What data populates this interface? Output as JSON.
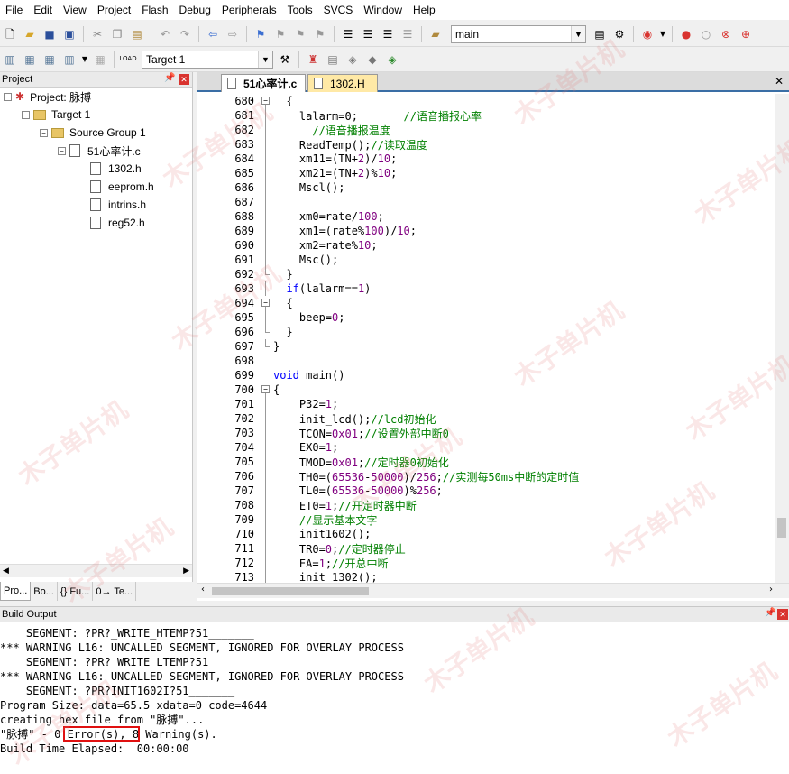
{
  "menu": [
    "File",
    "Edit",
    "View",
    "Project",
    "Flash",
    "Debug",
    "Peripherals",
    "Tools",
    "SVCS",
    "Window",
    "Help"
  ],
  "toolbar1": {
    "combo_value": "main"
  },
  "toolbar2": {
    "target_combo": "Target 1"
  },
  "project_panel": {
    "title": "Project",
    "tree": {
      "project": "Project: 脉搏",
      "target": "Target 1",
      "group": "Source Group 1",
      "file": "51心率计.c",
      "headers": [
        "1302.h",
        "eeprom.h",
        "intrins.h",
        "reg52.h"
      ]
    },
    "tabs": [
      "Pro...",
      "Bo...",
      "{} Fu...",
      "0→ Te..."
    ]
  },
  "editor": {
    "tabs": [
      {
        "label": "51心率计.c",
        "active": true
      },
      {
        "label": "1302.H",
        "active": false
      }
    ],
    "lines": [
      {
        "n": "680",
        "fold": "box",
        "html": "  {"
      },
      {
        "n": "681",
        "fold": "line",
        "html": "    lalarm=0;       <span class='cm'>//语音播报心率</span>"
      },
      {
        "n": "682",
        "fold": "line",
        "html": "      <span class='cm'>//语音播报温度</span>"
      },
      {
        "n": "683",
        "fold": "line",
        "html": "    ReadTemp();<span class='cm'>//读取温度</span>"
      },
      {
        "n": "684",
        "fold": "line",
        "html": "    xm11=(TN+<span class='nm'>2</span>)/<span class='nm'>10</span>;"
      },
      {
        "n": "685",
        "fold": "line",
        "html": "    xm21=(TN+<span class='nm'>2</span>)%<span class='nm'>10</span>;"
      },
      {
        "n": "686",
        "fold": "line",
        "html": "    Mscl();"
      },
      {
        "n": "687",
        "fold": "line",
        "html": ""
      },
      {
        "n": "688",
        "fold": "line",
        "html": "    xm0=rate/<span class='nm'>100</span>;"
      },
      {
        "n": "689",
        "fold": "line",
        "html": "    xm1=(rate%<span class='nm'>100</span>)/<span class='nm'>10</span>;"
      },
      {
        "n": "690",
        "fold": "line",
        "html": "    xm2=rate%<span class='nm'>10</span>;"
      },
      {
        "n": "691",
        "fold": "line",
        "html": "    Msc();"
      },
      {
        "n": "692",
        "fold": "end",
        "html": "  }"
      },
      {
        "n": "693",
        "fold": "line",
        "html": "  <span class='kw'>if</span>(lalarm==<span class='nm'>1</span>)"
      },
      {
        "n": "694",
        "fold": "box",
        "html": "  {"
      },
      {
        "n": "695",
        "fold": "line",
        "html": "    beep=<span class='nm'>0</span>;"
      },
      {
        "n": "696",
        "fold": "end",
        "html": "  }"
      },
      {
        "n": "697",
        "fold": "end",
        "html": "}"
      },
      {
        "n": "698",
        "fold": "none",
        "html": ""
      },
      {
        "n": "699",
        "fold": "none",
        "html": "<span class='kw'>void</span> main()"
      },
      {
        "n": "700",
        "fold": "box",
        "html": "{"
      },
      {
        "n": "701",
        "fold": "line",
        "html": "    P32=<span class='nm'>1</span>;"
      },
      {
        "n": "702",
        "fold": "line",
        "html": "    init_lcd();<span class='cm'>//lcd初始化</span>"
      },
      {
        "n": "703",
        "fold": "line",
        "html": "    TCON=<span class='nm'>0x01</span>;<span class='cm'>//设置外部中断0</span>"
      },
      {
        "n": "704",
        "fold": "line",
        "html": "    EX0=<span class='nm'>1</span>;"
      },
      {
        "n": "705",
        "fold": "line",
        "html": "    TMOD=<span class='nm'>0x01</span>;<span class='cm'>//定时器0初始化</span>"
      },
      {
        "n": "706",
        "fold": "line",
        "html": "    TH0=(<span class='nm'>65536</span>-<span class='nm'>50000</span>)/<span class='nm'>256</span>;<span class='cm'>//实测每50ms中断的定时值</span>"
      },
      {
        "n": "707",
        "fold": "line",
        "html": "    TL0=(<span class='nm'>65536</span>-<span class='nm'>50000</span>)%<span class='nm'>256</span>;"
      },
      {
        "n": "708",
        "fold": "line",
        "html": "    ET0=<span class='nm'>1</span>;<span class='cm'>//开定时器中断</span>"
      },
      {
        "n": "709",
        "fold": "line",
        "html": "    <span class='cm'>//显示基本文字</span>"
      },
      {
        "n": "710",
        "fold": "line",
        "html": "    init1602();"
      },
      {
        "n": "711",
        "fold": "line",
        "html": "    TR0=<span class='nm'>0</span>;<span class='cm'>//定时器停止</span>"
      },
      {
        "n": "712",
        "fold": "line",
        "html": "    EA=<span class='nm'>1</span>;<span class='cm'>//开总中断</span>"
      },
      {
        "n": "713",
        "fold": "line",
        "html": "    init_1302();"
      }
    ]
  },
  "build_output": {
    "title": "Build Output",
    "lines": [
      "    SEGMENT: ?PR?_WRITE_HTEMP?51_______",
      "*** WARNING L16: UNCALLED SEGMENT, IGNORED FOR OVERLAY PROCESS",
      "    SEGMENT: ?PR?_WRITE_LTEMP?51_______",
      "*** WARNING L16: UNCALLED SEGMENT, IGNORED FOR OVERLAY PROCESS",
      "    SEGMENT: ?PR?INIT1602I?51_______",
      "Program Size: data=65.5 xdata=0 code=4644",
      "creating hex file from \"脉搏\"...",
      "\"脉搏\" - 0 Error(s), 8 Warning(s).",
      "Build Time Elapsed:  00:00:00"
    ]
  },
  "watermark": "木子单片机"
}
